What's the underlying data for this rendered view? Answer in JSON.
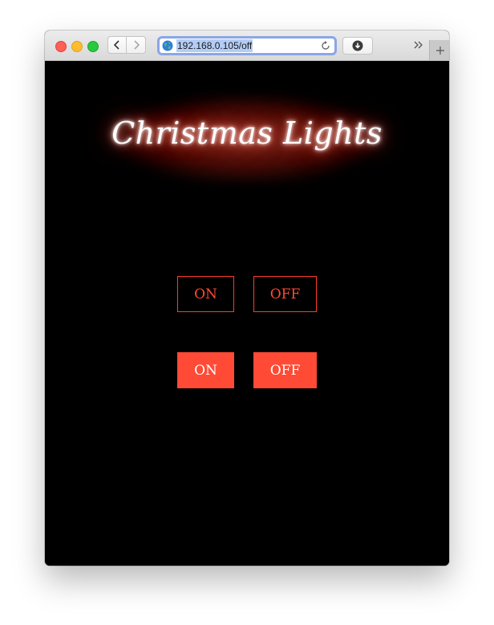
{
  "browser": {
    "address_url": "192.168.0.105/off",
    "accent_color": "#8aa6e6"
  },
  "page": {
    "title": "Christmas Lights",
    "outline_buttons": {
      "on_label": "ON",
      "off_label": "OFF"
    },
    "solid_buttons": {
      "on_label": "ON",
      "off_label": "OFF"
    },
    "colors": {
      "background": "#000000",
      "button_accent": "#ff4a35",
      "title_glow": "#c41e14"
    }
  },
  "icons": {
    "back": "chevron-left-icon",
    "forward": "chevron-right-icon",
    "site": "globe-icon",
    "reload": "reload-icon",
    "downloads": "download-icon",
    "overflow": "double-chevron-right-icon",
    "new_tab": "plus-icon"
  }
}
